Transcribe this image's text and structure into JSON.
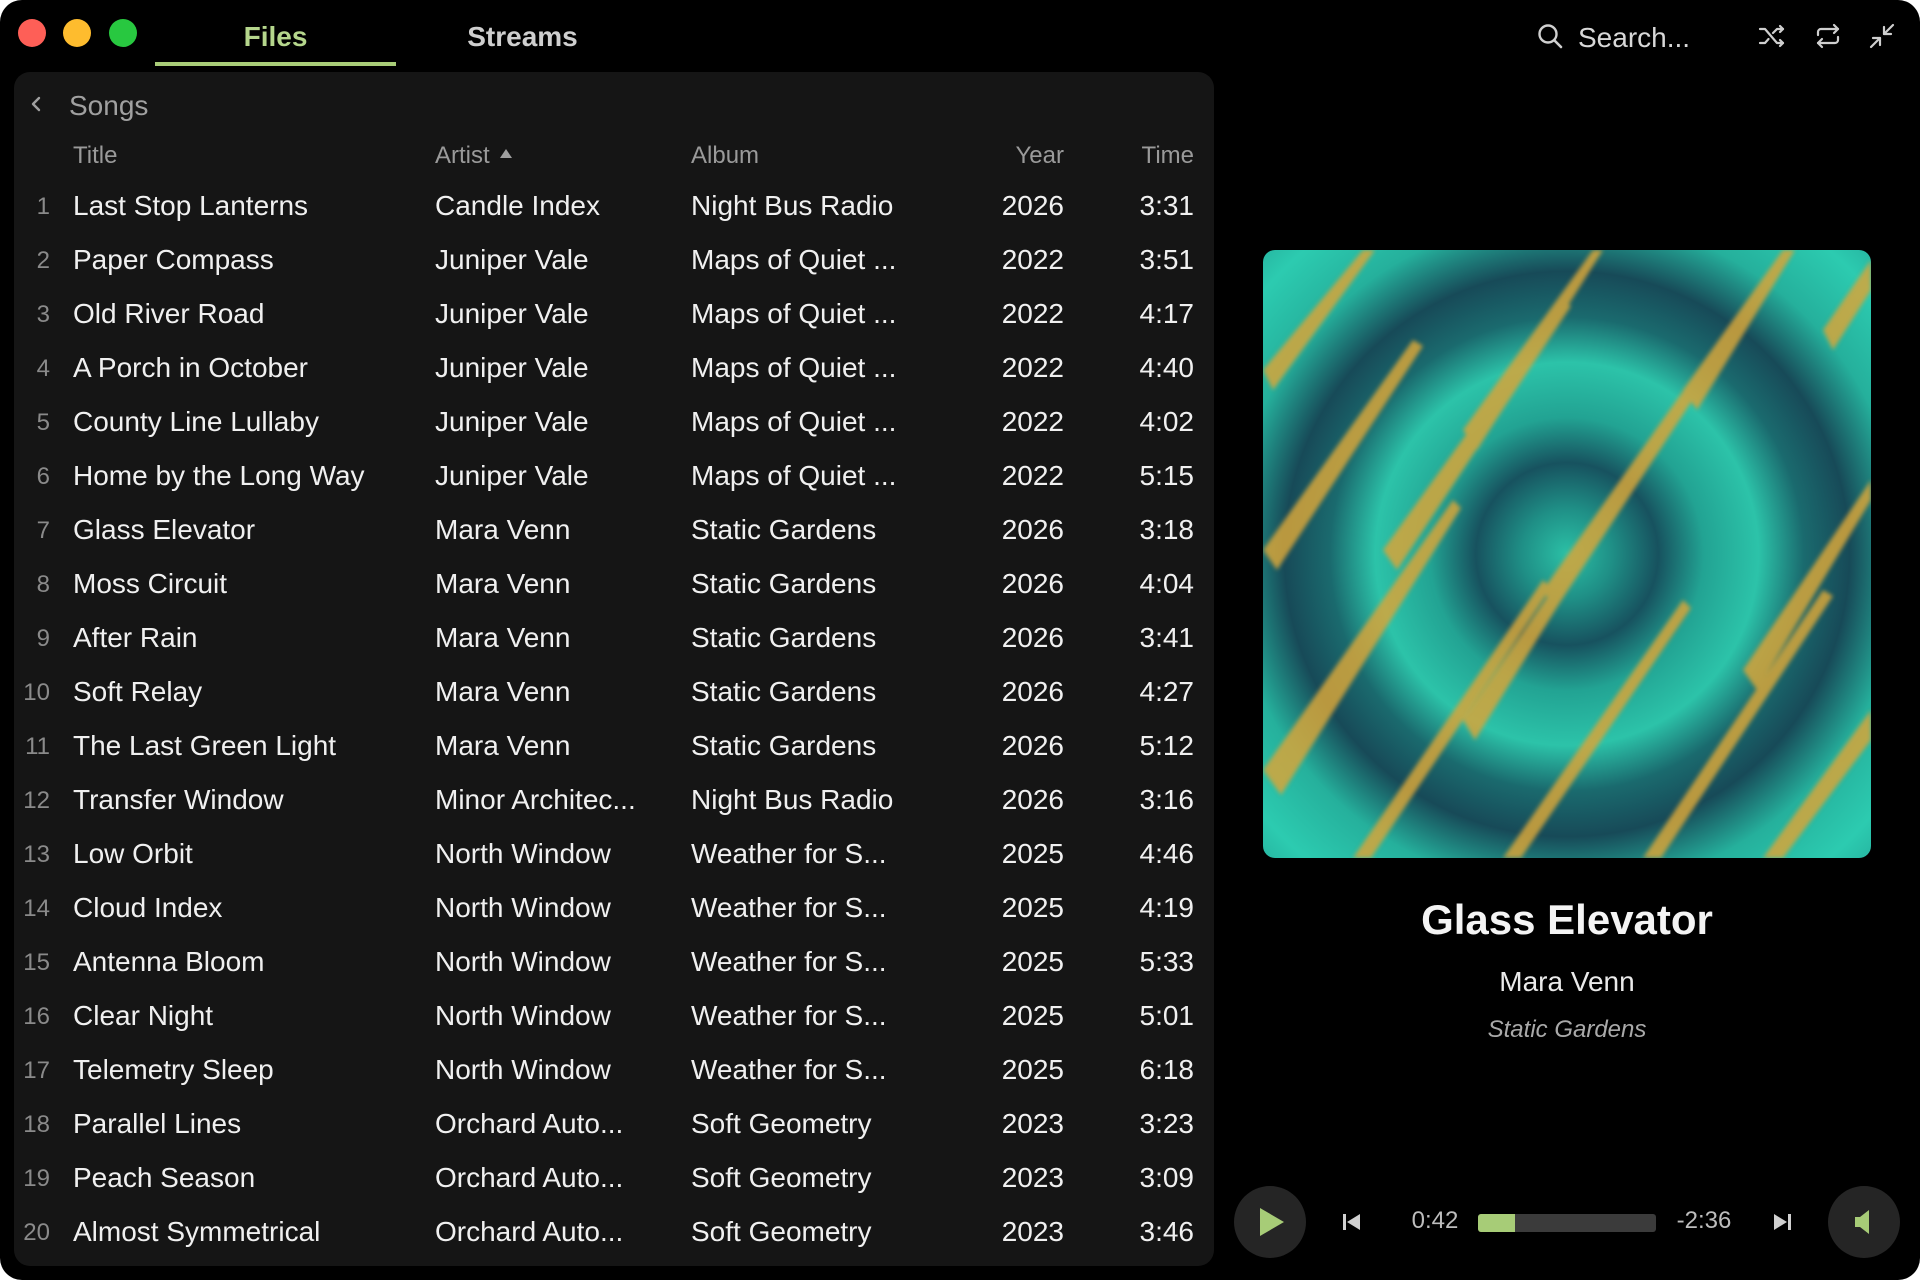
{
  "tabs": [
    {
      "label": "Files",
      "active": true
    },
    {
      "label": "Streams",
      "active": false
    }
  ],
  "search": {
    "placeholder": "Search..."
  },
  "breadcrumb": {
    "label": "Songs"
  },
  "columns": {
    "title": "Title",
    "artist": "Artist",
    "album": "Album",
    "year": "Year",
    "time": "Time",
    "sorted_by": "artist",
    "sort_direction": "ascending"
  },
  "songs": [
    {
      "num": "1",
      "title": "Last Stop Lanterns",
      "artist": "Candle Index",
      "album": "Night Bus Radio",
      "year": "2026",
      "time": "3:31"
    },
    {
      "num": "2",
      "title": "Paper Compass",
      "artist": "Juniper Vale",
      "album": "Maps of Quiet ...",
      "year": "2022",
      "time": "3:51"
    },
    {
      "num": "3",
      "title": "Old River Road",
      "artist": "Juniper Vale",
      "album": "Maps of Quiet ...",
      "year": "2022",
      "time": "4:17"
    },
    {
      "num": "4",
      "title": "A Porch in October",
      "artist": "Juniper Vale",
      "album": "Maps of Quiet ...",
      "year": "2022",
      "time": "4:40"
    },
    {
      "num": "5",
      "title": "County Line Lullaby",
      "artist": "Juniper Vale",
      "album": "Maps of Quiet ...",
      "year": "2022",
      "time": "4:02"
    },
    {
      "num": "6",
      "title": "Home by the Long Way",
      "artist": "Juniper Vale",
      "album": "Maps of Quiet ...",
      "year": "2022",
      "time": "5:15"
    },
    {
      "num": "7",
      "title": "Glass Elevator",
      "artist": "Mara Venn",
      "album": "Static Gardens",
      "year": "2026",
      "time": "3:18"
    },
    {
      "num": "8",
      "title": "Moss Circuit",
      "artist": "Mara Venn",
      "album": "Static Gardens",
      "year": "2026",
      "time": "4:04"
    },
    {
      "num": "9",
      "title": "After Rain",
      "artist": "Mara Venn",
      "album": "Static Gardens",
      "year": "2026",
      "time": "3:41"
    },
    {
      "num": "10",
      "title": "Soft Relay",
      "artist": "Mara Venn",
      "album": "Static Gardens",
      "year": "2026",
      "time": "4:27"
    },
    {
      "num": "11",
      "title": "The Last Green Light",
      "artist": "Mara Venn",
      "album": "Static Gardens",
      "year": "2026",
      "time": "5:12"
    },
    {
      "num": "12",
      "title": "Transfer Window",
      "artist": "Minor Architec...",
      "album": "Night Bus Radio",
      "year": "2026",
      "time": "3:16"
    },
    {
      "num": "13",
      "title": "Low Orbit",
      "artist": "North Window",
      "album": "Weather for S...",
      "year": "2025",
      "time": "4:46"
    },
    {
      "num": "14",
      "title": "Cloud Index",
      "artist": "North Window",
      "album": "Weather for S...",
      "year": "2025",
      "time": "4:19"
    },
    {
      "num": "15",
      "title": "Antenna Bloom",
      "artist": "North Window",
      "album": "Weather for S...",
      "year": "2025",
      "time": "5:33"
    },
    {
      "num": "16",
      "title": "Clear Night",
      "artist": "North Window",
      "album": "Weather for S...",
      "year": "2025",
      "time": "5:01"
    },
    {
      "num": "17",
      "title": "Telemetry Sleep",
      "artist": "North Window",
      "album": "Weather for S...",
      "year": "2025",
      "time": "6:18"
    },
    {
      "num": "18",
      "title": "Parallel Lines",
      "artist": "Orchard Auto...",
      "album": "Soft Geometry",
      "year": "2023",
      "time": "3:23"
    },
    {
      "num": "19",
      "title": "Peach Season",
      "artist": "Orchard Auto...",
      "album": "Soft Geometry",
      "year": "2023",
      "time": "3:09"
    },
    {
      "num": "20",
      "title": "Almost Symmetrical",
      "artist": "Orchard Auto...",
      "album": "Soft Geometry",
      "year": "2023",
      "time": "3:46"
    }
  ],
  "now_playing": {
    "title": "Glass Elevator",
    "artist": "Mara Venn",
    "album": "Static Gardens",
    "elapsed": "0:42",
    "remaining": "-2:36",
    "progress_fraction": 0.21
  },
  "icons": {
    "search": "search-icon",
    "shuffle": "shuffle-icon",
    "repeat": "repeat-icon",
    "minimize": "minimize-icon",
    "back": "chevron-left-icon",
    "play": "play-icon",
    "previous": "skip-previous-icon",
    "next": "skip-next-icon",
    "volume": "volume-icon"
  },
  "colors": {
    "accent": "#a7cc77",
    "active_tab": "#b5d68c",
    "window_bg": "#000000",
    "panel_bg": "#151515",
    "traffic_close": "#fe5f57",
    "traffic_minimize": "#febc2e",
    "traffic_maximize": "#28c840"
  }
}
